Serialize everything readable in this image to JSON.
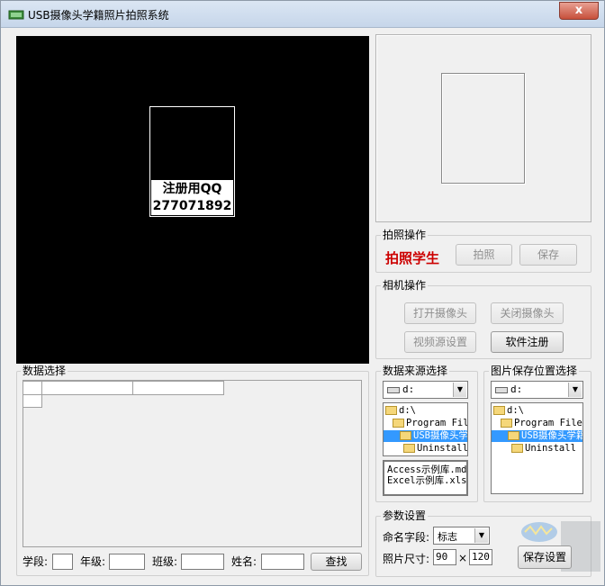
{
  "window": {
    "title": "USB摄像头学籍照片拍照系统",
    "close_glyph": "x"
  },
  "preview": {
    "reg_line1": "注册用QQ",
    "reg_line2": "277071892"
  },
  "capture": {
    "group_label": "拍照操作",
    "student_label": "拍照学生",
    "capture_button": "拍照",
    "save_button": "保存"
  },
  "camera": {
    "group_label": "相机操作",
    "open_button": "打开摄像头",
    "close_button": "关闭摄像头",
    "video_source_button": "视频源设置",
    "register_button": "软件注册"
  },
  "data_selection": {
    "group_label": "数据选择"
  },
  "data_source": {
    "group_label": "数据来源选择",
    "drive": "d:",
    "tree": [
      "d:\\",
      "Program Fil",
      "USB摄像头学",
      "Uninstall"
    ],
    "files": [
      "Access示例库.md",
      "Excel示例库.xls"
    ]
  },
  "save_location": {
    "group_label": "图片保存位置选择",
    "drive": "d:",
    "tree": [
      "d:\\",
      "Program Files",
      "USB摄像头学籍",
      "Uninstall"
    ]
  },
  "search": {
    "school_label": "学段:",
    "grade_label": "年级:",
    "class_label": "班级:",
    "name_label": "姓名:",
    "search_button": "查找"
  },
  "params": {
    "group_label": "参数设置",
    "naming_label": "命名字段:",
    "naming_value": "标志",
    "size_label": "照片尺寸:",
    "width": "90",
    "times": "×",
    "height": "120",
    "save_button": "保存设置"
  },
  "colors": {
    "accent_red": "#cc0000",
    "selection": "#3399ff"
  }
}
